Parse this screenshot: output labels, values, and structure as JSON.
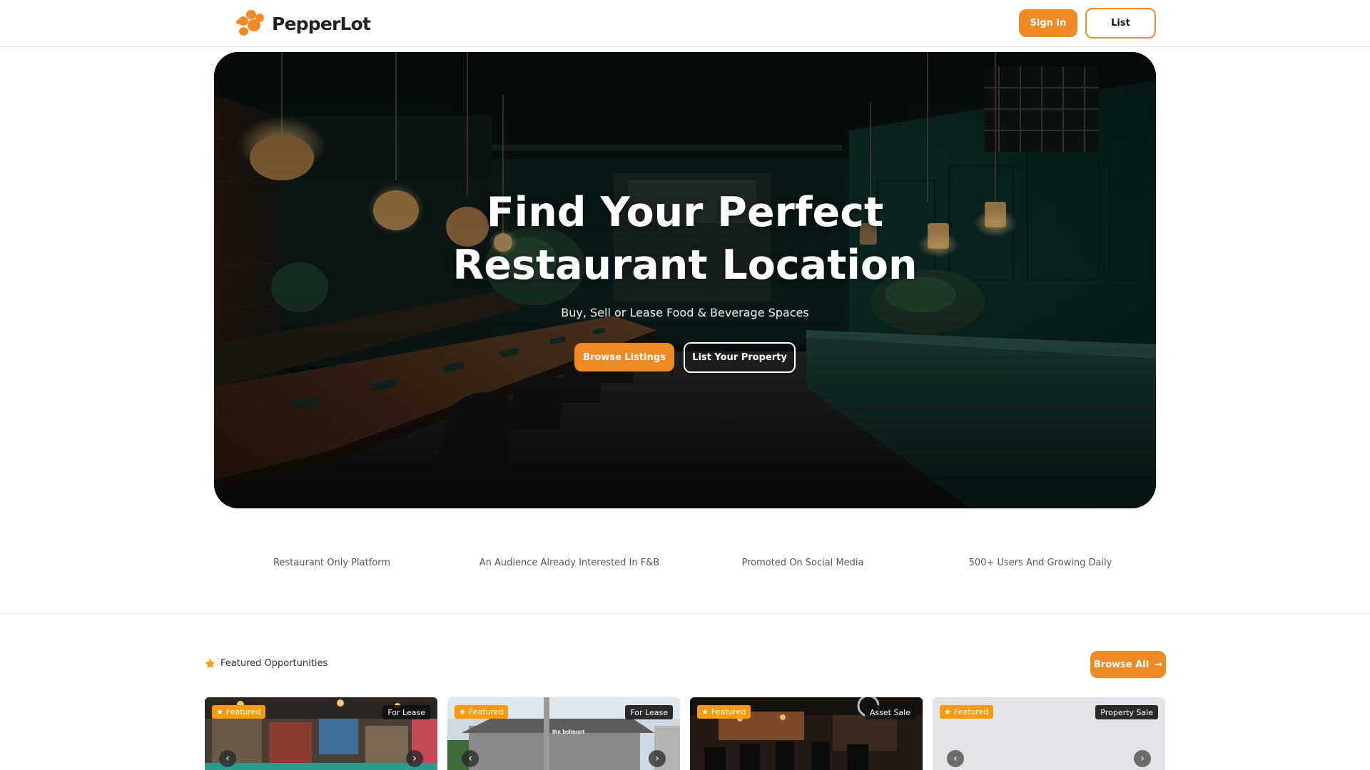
{
  "header": {
    "logo_text": "PepperLot",
    "sign_in_label": "Sign In",
    "list_label": "List"
  },
  "hero": {
    "title_line1": "Find Your Perfect",
    "title_line2": "Restaurant Location",
    "subtitle": "Buy, Sell or Lease Food & Beverage Spaces",
    "browse_label": "Browse Listings",
    "list_property_label": "List Your Property"
  },
  "features": [
    "Restaurant Only Platform",
    "An Audience Already Interested In F&B",
    "Promoted On Social Media",
    "500+ Users And Growing Daily"
  ],
  "featured": {
    "title": "Featured Opportunities",
    "browse_all_label": "Browse All",
    "icon": "star-icon"
  },
  "cards": [
    {
      "badge": "Featured",
      "type": "For Lease"
    },
    {
      "badge": "Featured",
      "type": "For Lease",
      "sign_text": "the belmont"
    },
    {
      "badge": "Featured",
      "type": "Asset Sale"
    },
    {
      "badge": "Featured",
      "type": "Property Sale"
    }
  ],
  "colors": {
    "accent": "#f08a24",
    "badge_featured": "#f39c12",
    "badge_type": "#111111"
  }
}
